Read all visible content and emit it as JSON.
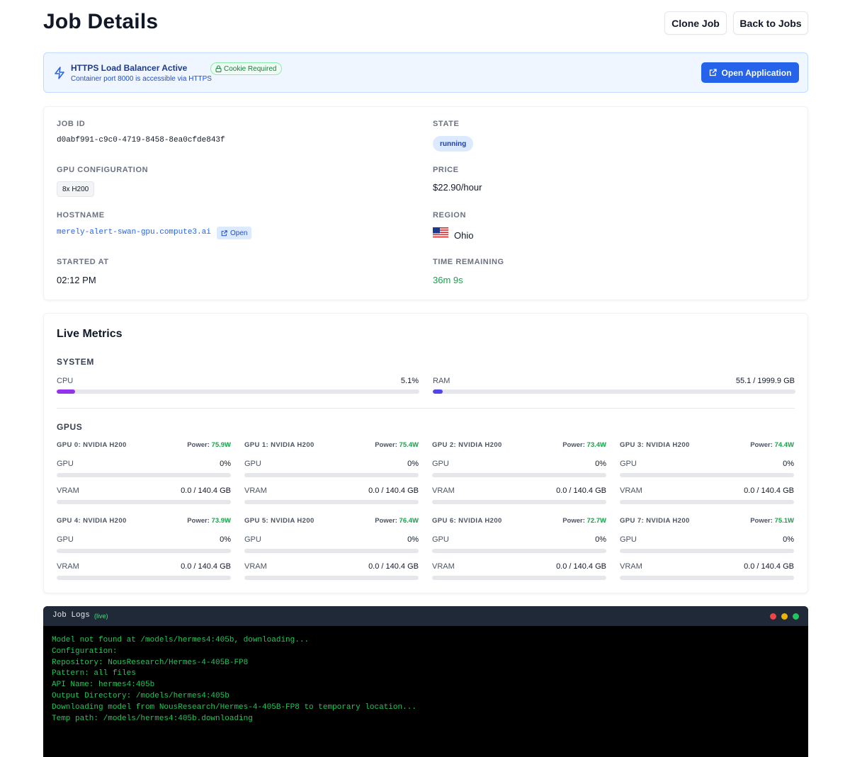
{
  "page": {
    "title": "Job Details",
    "clone_label": "Clone Job",
    "back_label": "Back to Jobs"
  },
  "banner": {
    "title": "HTTPS Load Balancer Active",
    "cookie": "Cookie Required",
    "subtitle": "Container port 8000 is accessible via HTTPS",
    "open_label": "Open Application",
    "icon": "bolt-icon"
  },
  "details": {
    "job_id_label": "JOB ID",
    "job_id": "d0abf991-c9c0-4719-8458-8ea0cfde843f",
    "state_label": "STATE",
    "state": "running",
    "gpu_label": "GPU CONFIGURATION",
    "gpu": "8x H200",
    "price_label": "PRICE",
    "price": "$22.90/hour",
    "hostname_label": "HOSTNAME",
    "hostname": "merely-alert-swan-gpu.compute3.ai",
    "open_label": "Open",
    "region_label": "REGION",
    "region": "Ohio",
    "started_label": "STARTED AT",
    "started": "02:12 PM",
    "remaining_label": "TIME REMAINING",
    "remaining": "36m 9s"
  },
  "metrics": {
    "title": "Live Metrics",
    "system_label": "SYSTEM",
    "cpu": {
      "label": "CPU",
      "value": "5.1%",
      "fraction": 0.051,
      "color": "#9333ea"
    },
    "ram": {
      "label": "RAM",
      "value": "55.1 / 1999.9 GB",
      "fraction": 0.0276,
      "color": "#4f46e5"
    },
    "gpus_label": "GPUS",
    "gpus": [
      {
        "name": "GPU 0: NVIDIA H200",
        "power_label": "Power:",
        "power": "75.9W",
        "util_label": "GPU",
        "util": "0%",
        "util_fraction": 0,
        "vram_label": "VRAM",
        "vram": "0.0 / 140.4 GB",
        "vram_fraction": 0
      },
      {
        "name": "GPU 1: NVIDIA H200",
        "power_label": "Power:",
        "power": "75.4W",
        "util_label": "GPU",
        "util": "0%",
        "util_fraction": 0,
        "vram_label": "VRAM",
        "vram": "0.0 / 140.4 GB",
        "vram_fraction": 0
      },
      {
        "name": "GPU 2: NVIDIA H200",
        "power_label": "Power:",
        "power": "73.4W",
        "util_label": "GPU",
        "util": "0%",
        "util_fraction": 0,
        "vram_label": "VRAM",
        "vram": "0.0 / 140.4 GB",
        "vram_fraction": 0
      },
      {
        "name": "GPU 3: NVIDIA H200",
        "power_label": "Power:",
        "power": "74.4W",
        "util_label": "GPU",
        "util": "0%",
        "util_fraction": 0,
        "vram_label": "VRAM",
        "vram": "0.0 / 140.4 GB",
        "vram_fraction": 0
      },
      {
        "name": "GPU 4: NVIDIA H200",
        "power_label": "Power:",
        "power": "73.9W",
        "util_label": "GPU",
        "util": "0%",
        "util_fraction": 0,
        "vram_label": "VRAM",
        "vram": "0.0 / 140.4 GB",
        "vram_fraction": 0
      },
      {
        "name": "GPU 5: NVIDIA H200",
        "power_label": "Power:",
        "power": "76.4W",
        "util_label": "GPU",
        "util": "0%",
        "util_fraction": 0,
        "vram_label": "VRAM",
        "vram": "0.0 / 140.4 GB",
        "vram_fraction": 0
      },
      {
        "name": "GPU 6: NVIDIA H200",
        "power_label": "Power:",
        "power": "72.7W",
        "util_label": "GPU",
        "util": "0%",
        "util_fraction": 0,
        "vram_label": "VRAM",
        "vram": "0.0 / 140.4 GB",
        "vram_fraction": 0
      },
      {
        "name": "GPU 7: NVIDIA H200",
        "power_label": "Power:",
        "power": "75.1W",
        "util_label": "GPU",
        "util": "0%",
        "util_fraction": 0,
        "vram_label": "VRAM",
        "vram": "0.0 / 140.4 GB",
        "vram_fraction": 0
      }
    ]
  },
  "logs": {
    "title": "Job Logs",
    "live": "(live)",
    "lines": [
      "Model not found at /models/hermes4:405b, downloading...",
      "Configuration:",
      "Repository: NousResearch/Hermes-4-405B-FP8",
      "Pattern: all files",
      "API Name: hermes4:405b",
      "Output Directory: /models/hermes4:405b",
      "Downloading model from NousResearch/Hermes-4-405B-FP8 to temporary location...",
      "Temp path: /models/hermes4:405b.downloading"
    ],
    "dot_colors": [
      "#ef4444",
      "#eab308",
      "#22c55e"
    ]
  }
}
